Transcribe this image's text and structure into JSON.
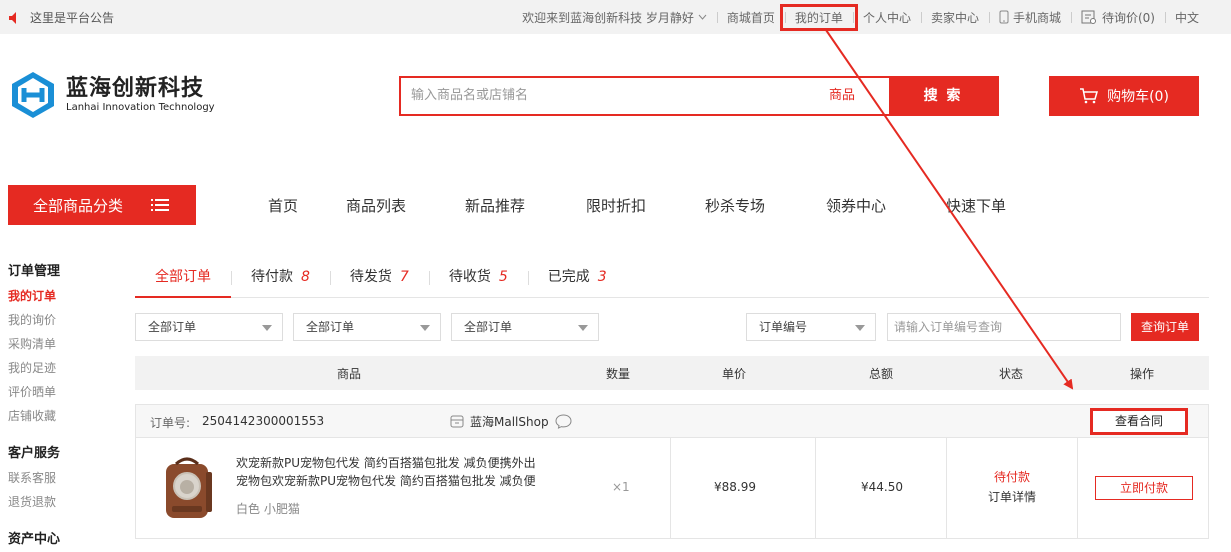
{
  "topbar": {
    "notice": "这里是平台公告",
    "welcome": "欢迎来到蓝海创新科技 岁月静好",
    "links": [
      "商城首页",
      "我的订单",
      "个人中心",
      "卖家中心",
      "手机商城",
      "待询价(0)",
      "中文"
    ]
  },
  "header": {
    "logo_cn": "蓝海创新科技",
    "logo_en": "Lanhai Innovation Technology",
    "search_placeholder": "输入商品名或店铺名",
    "search_type": "商品",
    "search_button": "搜 索",
    "cart": "购物车(0)"
  },
  "nav": {
    "all_categories": "全部商品分类",
    "items": [
      "首页",
      "商品列表",
      "新品推荐",
      "限时折扣",
      "秒杀专场",
      "领券中心",
      "快速下单"
    ]
  },
  "sidebar": {
    "groups": [
      {
        "title": "订单管理",
        "items": [
          "我的订单",
          "我的询价",
          "采购清单",
          "我的足迹",
          "评价晒单",
          "店铺收藏"
        ]
      },
      {
        "title": "客户服务",
        "items": [
          "联系客服",
          "退货退款"
        ]
      },
      {
        "title": "资产中心",
        "items": []
      }
    ]
  },
  "tabs": [
    {
      "label": "全部订单",
      "count": ""
    },
    {
      "label": "待付款",
      "count": "8"
    },
    {
      "label": "待发货",
      "count": "7"
    },
    {
      "label": "待收货",
      "count": "5"
    },
    {
      "label": "已完成",
      "count": "3"
    }
  ],
  "filters": {
    "select1": "全部订单",
    "select2": "全部订单",
    "select3": "全部订单",
    "select4": "订单编号",
    "order_placeholder": "请输入订单编号查询",
    "query_button": "查询订单"
  },
  "table_header": [
    "商品",
    "数量",
    "单价",
    "总额",
    "状态",
    "操作"
  ],
  "order": {
    "label": "订单号:",
    "number": "2504142300001553",
    "shop": "蓝海MallShop",
    "contract_button": "查看合同",
    "product_title": "欢宠新款PU宠物包代发 简约百搭猫包批发 减负便携外出宠物包欢宠新款PU宠物包代发 简约百搭猫包批发 减负便",
    "variant": "白色 小肥猫",
    "qty": "×1",
    "unit_price": "¥88.99",
    "total": "¥44.50",
    "status": "待付款",
    "detail": "订单详情",
    "pay_button": "立即付款"
  },
  "colors": {
    "accent": "#e52a22",
    "logo_blue": "#1a8fd6"
  }
}
